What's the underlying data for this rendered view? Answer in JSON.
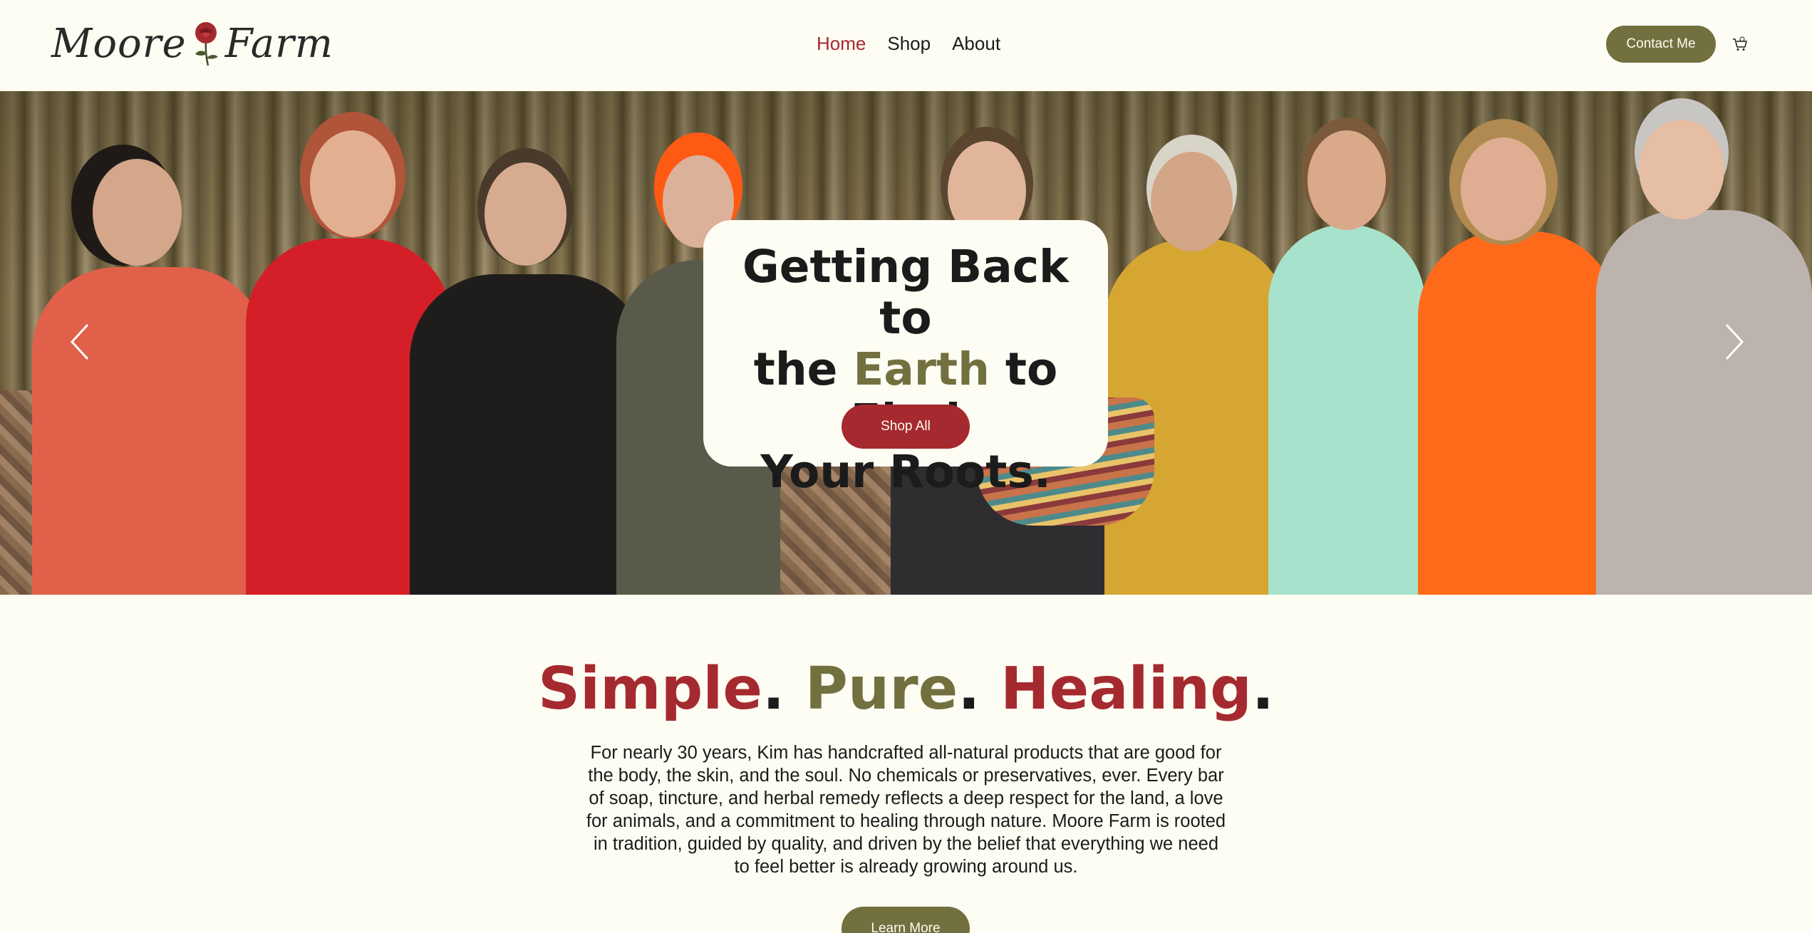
{
  "header": {
    "logo_left": "Moore",
    "logo_right": "Farm",
    "nav": [
      {
        "label": "Home",
        "active": true
      },
      {
        "label": "Shop",
        "active": false
      },
      {
        "label": "About",
        "active": false
      }
    ],
    "contact_label": "Contact Me",
    "cart_icon": "cart-icon"
  },
  "hero": {
    "title_line1": "Getting Back to",
    "title_the": "the ",
    "title_earth": "Earth",
    "title_rest": " to Find",
    "title_line3": "Your Roots.",
    "shop_label": "Shop All",
    "prev_icon": "chevron-left-icon",
    "next_icon": "chevron-right-icon"
  },
  "intro": {
    "word1": "Simple",
    "word2": "Pure",
    "word3": "Healing",
    "dot": ".",
    "body": "For nearly 30 years, Kim has handcrafted all-natural products that are good for the body, the skin, and the soul. No chemicals or preservatives, ever. Every bar of soap, tincture, and herbal remedy reflects a deep respect for the land, a love for animals, and a commitment to healing through nature. Moore Farm is rooted in tradition, guided by quality, and driven by the belief that everything we need to feel better is already growing around us.",
    "learn_label": "Learn More"
  },
  "colors": {
    "background": "#fefdf3",
    "accent_red": "#a52a2f",
    "accent_olive": "#72703f"
  }
}
